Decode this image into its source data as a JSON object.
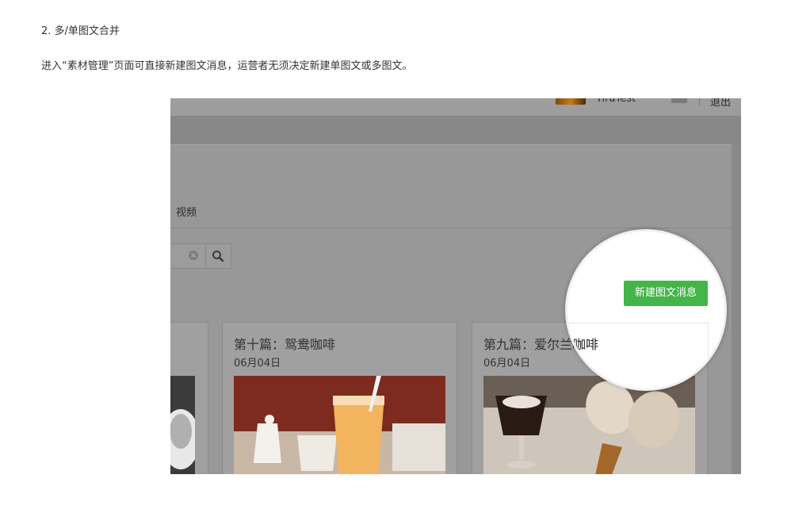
{
  "article": {
    "heading": "2. 多/单图文合并",
    "intro": "进入“素材管理”页面可直接新建图文消息，运营者无须决定新建单图文或多图文。"
  },
  "screenshot": {
    "topbar": {
      "username": "TiraTest",
      "logout": "退出"
    },
    "tabs": {
      "video": "视频"
    },
    "search": {
      "clear_icon": "clear-circle-icon",
      "search_icon": "magnifier-icon"
    },
    "new_button": "新建图文消息",
    "cards": [
      {
        "title": "第十篇：鸳鸯咖啡",
        "date": "06月04日"
      },
      {
        "title": "第九篇：爱尔兰咖啡",
        "date": "06月04日"
      }
    ],
    "colors": {
      "accent_green": "#44b549",
      "dim_gray": "#989898"
    }
  }
}
